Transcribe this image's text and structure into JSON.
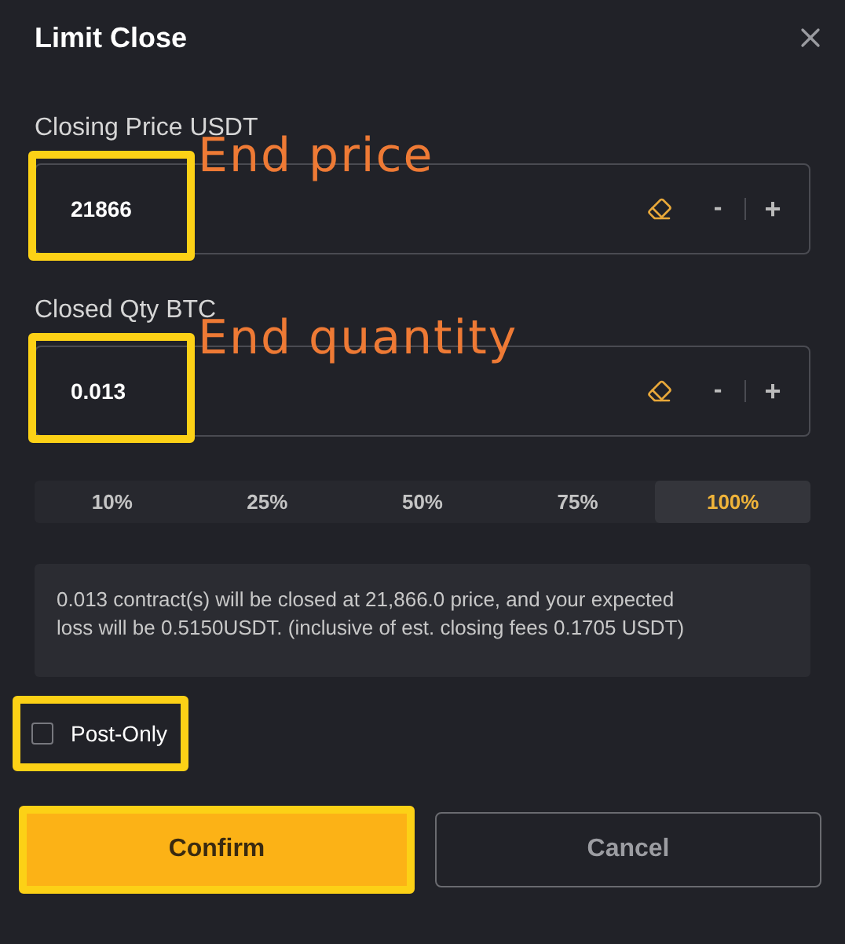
{
  "dialog": {
    "title": "Limit Close"
  },
  "fields": [
    {
      "label": "Closing Price USDT",
      "value": "21866",
      "highlighted": true,
      "annotation": "End price",
      "decrement": "-",
      "increment": "+"
    },
    {
      "label": "Closed Qty BTC",
      "value": "0.013",
      "highlighted": true,
      "annotation": "End quantity",
      "decrement": "-",
      "increment": "+"
    }
  ],
  "percent_options": [
    {
      "label": "10%",
      "selected": false
    },
    {
      "label": "25%",
      "selected": false
    },
    {
      "label": "50%",
      "selected": false
    },
    {
      "label": "75%",
      "selected": false
    },
    {
      "label": "100%",
      "selected": true
    }
  ],
  "summary": "0.013 contract(s) will be closed at 21,866.0 price, and your expected loss will be 0.5150USDT. (inclusive of est. closing fees 0.1705 USDT)",
  "post_only": {
    "label": "Post-Only",
    "checked": false,
    "highlighted": true
  },
  "buttons": [
    {
      "label": "Confirm",
      "kind": "primary",
      "highlighted": true
    },
    {
      "label": "Cancel",
      "kind": "secondary",
      "highlighted": false
    }
  ]
}
